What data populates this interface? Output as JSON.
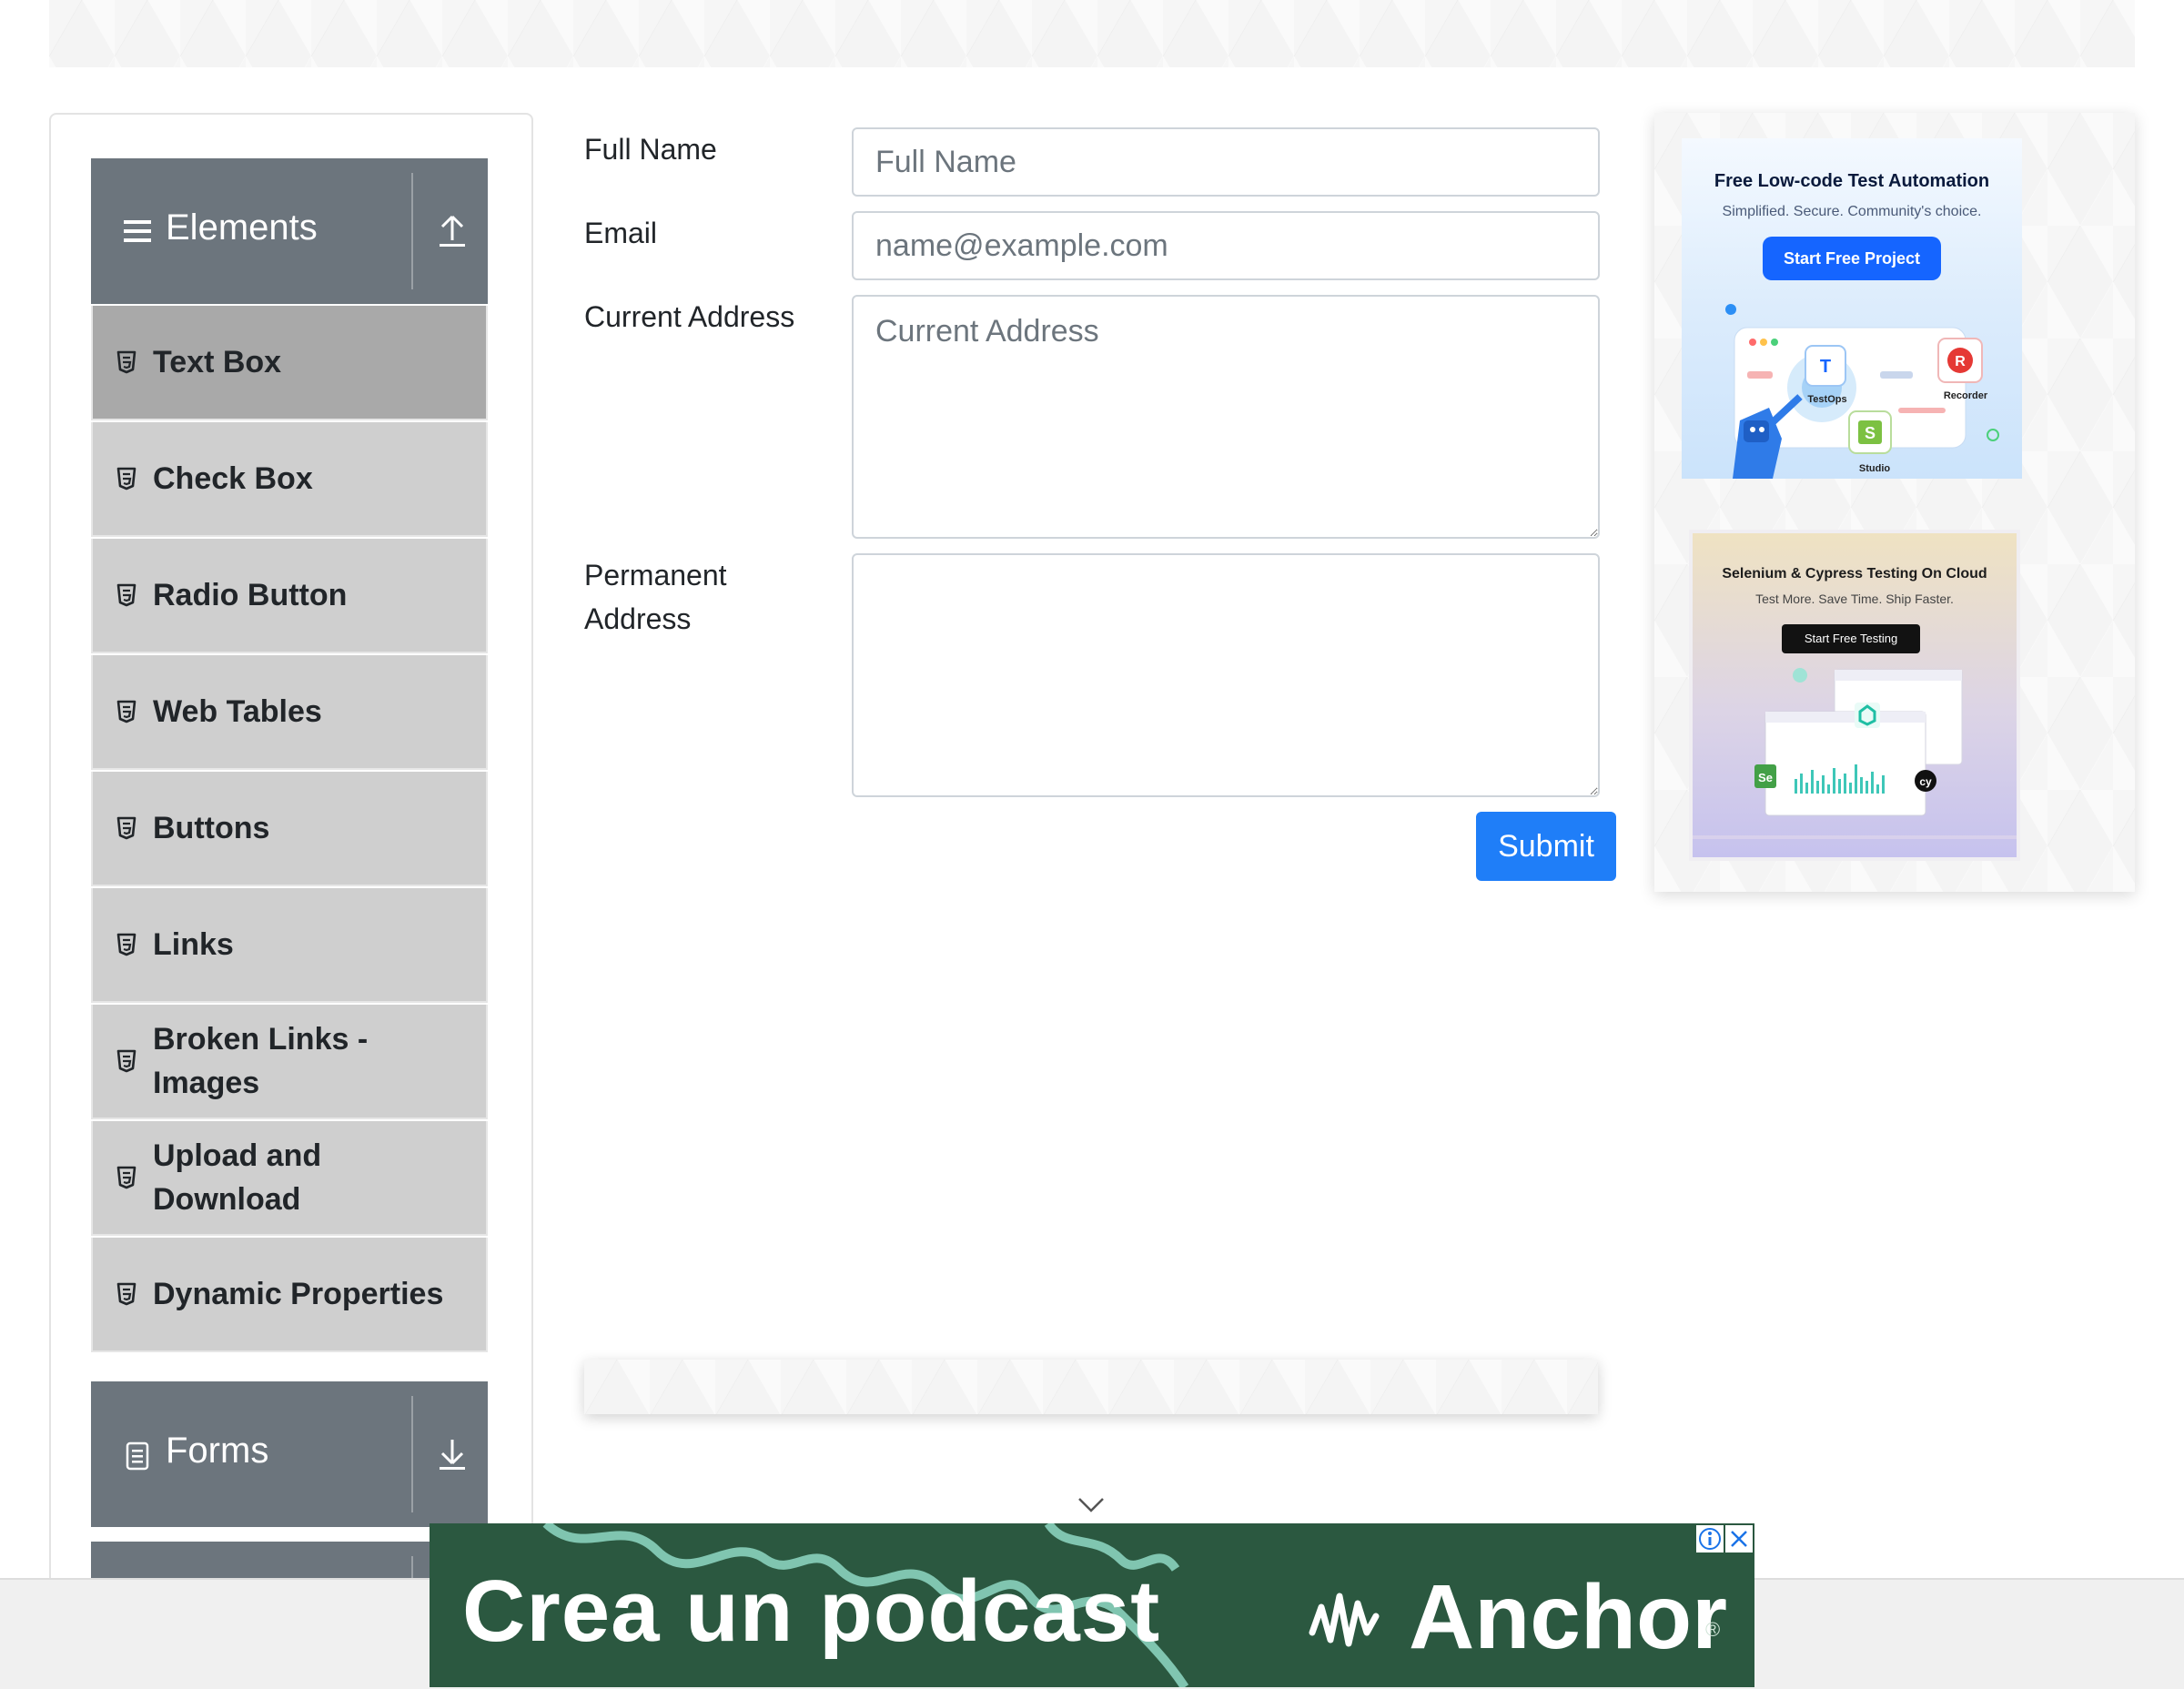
{
  "sidebar": {
    "elements_group": {
      "title": "Elements",
      "icon": "hamburger-menu-icon",
      "toggle_icon": "collapse-arrow-up-icon"
    },
    "items": [
      {
        "label": "Text Box",
        "active": true
      },
      {
        "label": "Check Box"
      },
      {
        "label": "Radio Button"
      },
      {
        "label": "Web Tables"
      },
      {
        "label": "Buttons"
      },
      {
        "label": "Links"
      },
      {
        "label": "Broken Links - Images"
      },
      {
        "label": "Upload and Download"
      },
      {
        "label": "Dynamic Properties"
      }
    ],
    "item_icon": "html5-shield-icon",
    "forms_group": {
      "title": "Forms",
      "icon": "document-icon",
      "toggle_icon": "expand-arrow-down-icon"
    }
  },
  "form": {
    "full_name": {
      "label": "Full Name",
      "placeholder": "Full Name",
      "value": ""
    },
    "email": {
      "label": "Email",
      "placeholder": "name@example.com",
      "value": ""
    },
    "current_address": {
      "label": "Current Address",
      "placeholder": "Current Address",
      "value": ""
    },
    "permanent_address": {
      "label": "Permanent Address",
      "placeholder": "",
      "value": ""
    },
    "submit_label": "Submit"
  },
  "ads": {
    "katalon": {
      "title": "Free Low-code Test Automation",
      "subtitle": "Simplified. Secure. Community's choice.",
      "cta": "Start Free Project"
    },
    "lambdatest": {
      "title": "Selenium & Cypress Testing On Cloud",
      "subtitle": "Test More. Save Time. Ship Faster.",
      "cta": "Start Free Testing"
    },
    "bottom": {
      "headline": "Crea un podcast",
      "brand": "Anchor",
      "reg": "®"
    }
  },
  "colors": {
    "sidebar_header": "#6c757d",
    "menu_item": "#cfcfcf",
    "menu_item_active": "#a9a9a9",
    "primary": "#1f7ef8",
    "bottom_ad_bg": "#2b5840"
  }
}
